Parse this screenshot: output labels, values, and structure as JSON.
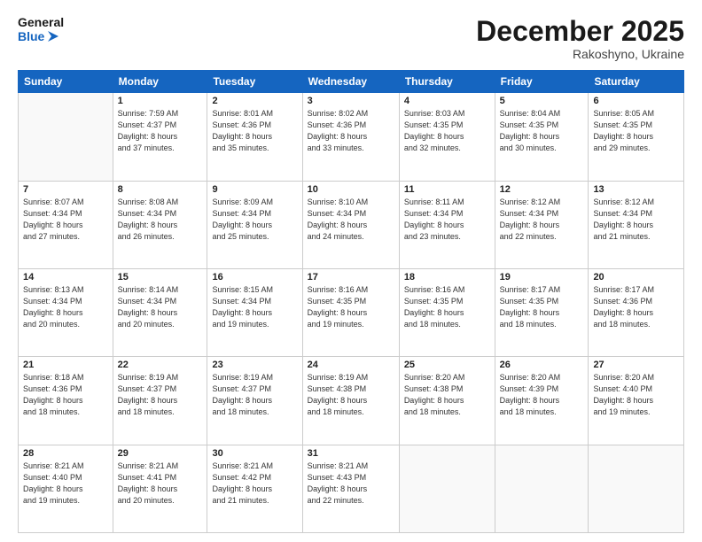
{
  "header": {
    "logo_line1": "General",
    "logo_line2": "Blue",
    "month": "December 2025",
    "location": "Rakoshyno, Ukraine"
  },
  "weekdays": [
    "Sunday",
    "Monday",
    "Tuesday",
    "Wednesday",
    "Thursday",
    "Friday",
    "Saturday"
  ],
  "weeks": [
    [
      {
        "day": "",
        "info": ""
      },
      {
        "day": "1",
        "info": "Sunrise: 7:59 AM\nSunset: 4:37 PM\nDaylight: 8 hours\nand 37 minutes."
      },
      {
        "day": "2",
        "info": "Sunrise: 8:01 AM\nSunset: 4:36 PM\nDaylight: 8 hours\nand 35 minutes."
      },
      {
        "day": "3",
        "info": "Sunrise: 8:02 AM\nSunset: 4:36 PM\nDaylight: 8 hours\nand 33 minutes."
      },
      {
        "day": "4",
        "info": "Sunrise: 8:03 AM\nSunset: 4:35 PM\nDaylight: 8 hours\nand 32 minutes."
      },
      {
        "day": "5",
        "info": "Sunrise: 8:04 AM\nSunset: 4:35 PM\nDaylight: 8 hours\nand 30 minutes."
      },
      {
        "day": "6",
        "info": "Sunrise: 8:05 AM\nSunset: 4:35 PM\nDaylight: 8 hours\nand 29 minutes."
      }
    ],
    [
      {
        "day": "7",
        "info": "Sunrise: 8:07 AM\nSunset: 4:34 PM\nDaylight: 8 hours\nand 27 minutes."
      },
      {
        "day": "8",
        "info": "Sunrise: 8:08 AM\nSunset: 4:34 PM\nDaylight: 8 hours\nand 26 minutes."
      },
      {
        "day": "9",
        "info": "Sunrise: 8:09 AM\nSunset: 4:34 PM\nDaylight: 8 hours\nand 25 minutes."
      },
      {
        "day": "10",
        "info": "Sunrise: 8:10 AM\nSunset: 4:34 PM\nDaylight: 8 hours\nand 24 minutes."
      },
      {
        "day": "11",
        "info": "Sunrise: 8:11 AM\nSunset: 4:34 PM\nDaylight: 8 hours\nand 23 minutes."
      },
      {
        "day": "12",
        "info": "Sunrise: 8:12 AM\nSunset: 4:34 PM\nDaylight: 8 hours\nand 22 minutes."
      },
      {
        "day": "13",
        "info": "Sunrise: 8:12 AM\nSunset: 4:34 PM\nDaylight: 8 hours\nand 21 minutes."
      }
    ],
    [
      {
        "day": "14",
        "info": "Sunrise: 8:13 AM\nSunset: 4:34 PM\nDaylight: 8 hours\nand 20 minutes."
      },
      {
        "day": "15",
        "info": "Sunrise: 8:14 AM\nSunset: 4:34 PM\nDaylight: 8 hours\nand 20 minutes."
      },
      {
        "day": "16",
        "info": "Sunrise: 8:15 AM\nSunset: 4:34 PM\nDaylight: 8 hours\nand 19 minutes."
      },
      {
        "day": "17",
        "info": "Sunrise: 8:16 AM\nSunset: 4:35 PM\nDaylight: 8 hours\nand 19 minutes."
      },
      {
        "day": "18",
        "info": "Sunrise: 8:16 AM\nSunset: 4:35 PM\nDaylight: 8 hours\nand 18 minutes."
      },
      {
        "day": "19",
        "info": "Sunrise: 8:17 AM\nSunset: 4:35 PM\nDaylight: 8 hours\nand 18 minutes."
      },
      {
        "day": "20",
        "info": "Sunrise: 8:17 AM\nSunset: 4:36 PM\nDaylight: 8 hours\nand 18 minutes."
      }
    ],
    [
      {
        "day": "21",
        "info": "Sunrise: 8:18 AM\nSunset: 4:36 PM\nDaylight: 8 hours\nand 18 minutes."
      },
      {
        "day": "22",
        "info": "Sunrise: 8:19 AM\nSunset: 4:37 PM\nDaylight: 8 hours\nand 18 minutes."
      },
      {
        "day": "23",
        "info": "Sunrise: 8:19 AM\nSunset: 4:37 PM\nDaylight: 8 hours\nand 18 minutes."
      },
      {
        "day": "24",
        "info": "Sunrise: 8:19 AM\nSunset: 4:38 PM\nDaylight: 8 hours\nand 18 minutes."
      },
      {
        "day": "25",
        "info": "Sunrise: 8:20 AM\nSunset: 4:38 PM\nDaylight: 8 hours\nand 18 minutes."
      },
      {
        "day": "26",
        "info": "Sunrise: 8:20 AM\nSunset: 4:39 PM\nDaylight: 8 hours\nand 18 minutes."
      },
      {
        "day": "27",
        "info": "Sunrise: 8:20 AM\nSunset: 4:40 PM\nDaylight: 8 hours\nand 19 minutes."
      }
    ],
    [
      {
        "day": "28",
        "info": "Sunrise: 8:21 AM\nSunset: 4:40 PM\nDaylight: 8 hours\nand 19 minutes."
      },
      {
        "day": "29",
        "info": "Sunrise: 8:21 AM\nSunset: 4:41 PM\nDaylight: 8 hours\nand 20 minutes."
      },
      {
        "day": "30",
        "info": "Sunrise: 8:21 AM\nSunset: 4:42 PM\nDaylight: 8 hours\nand 21 minutes."
      },
      {
        "day": "31",
        "info": "Sunrise: 8:21 AM\nSunset: 4:43 PM\nDaylight: 8 hours\nand 22 minutes."
      },
      {
        "day": "",
        "info": ""
      },
      {
        "day": "",
        "info": ""
      },
      {
        "day": "",
        "info": ""
      }
    ]
  ]
}
